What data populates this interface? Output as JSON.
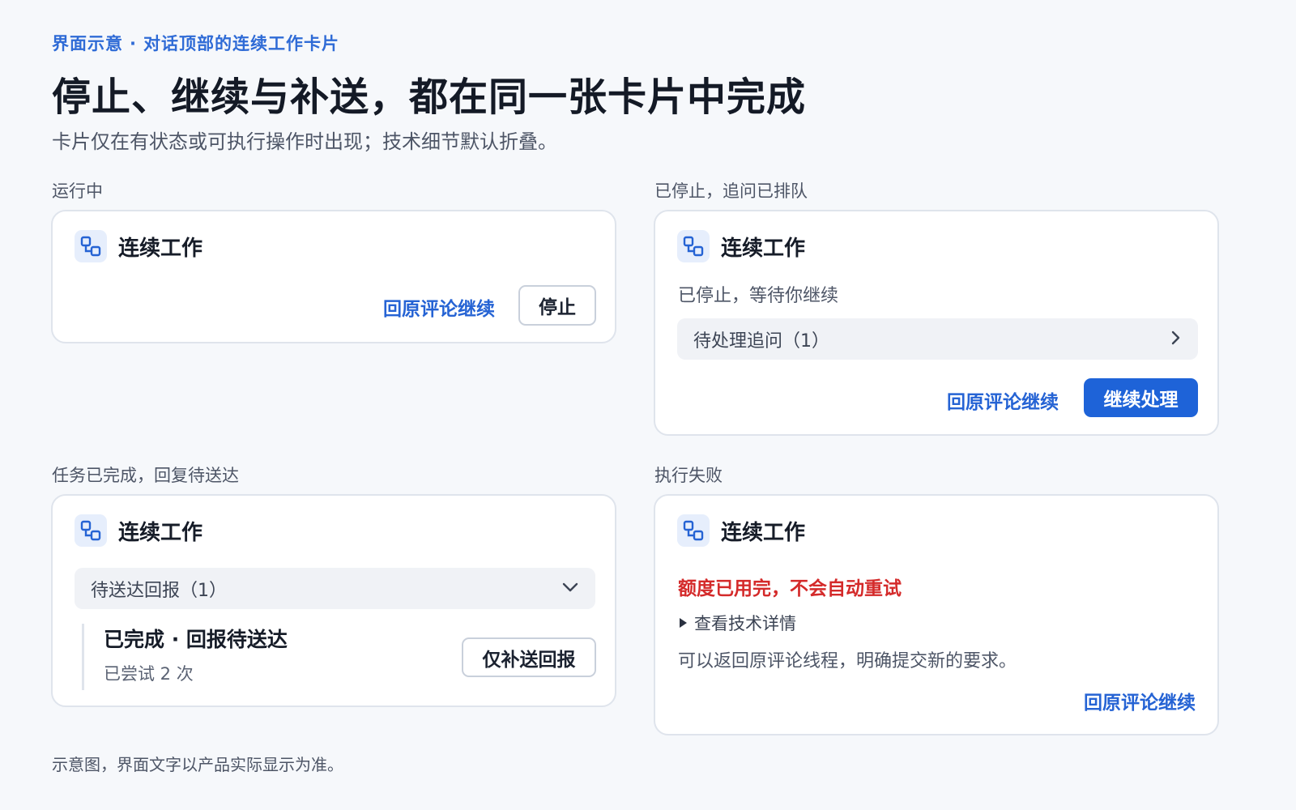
{
  "header": {
    "eyebrow_a": "界面示意",
    "eyebrow_sep": "·",
    "eyebrow_b": "对话顶部的连续工作卡片",
    "title": "停止、继续与补送，都在同一张卡片中完成",
    "subtitle": "卡片仅在有状态或可执行操作时出现；技术细节默认折叠。"
  },
  "running": {
    "label": "运行中",
    "card_title": "连续工作",
    "icon": "flow-icon",
    "link": "回原评论继续",
    "button": "停止"
  },
  "stopped": {
    "label": "已停止，追问已排队",
    "card_title": "连续工作",
    "icon": "flow-icon",
    "status": "已停止，等待你继续",
    "queue_row": "待处理追问（1）",
    "queue_icon": "chevron-right-icon",
    "link": "回原评论继续",
    "button": "继续处理"
  },
  "completed": {
    "label": "任务已完成，回复待送达",
    "card_title": "连续工作",
    "icon": "flow-icon",
    "pending_row": "待送达回报（1）",
    "pending_icon": "chevron-down-icon",
    "item_title": "已完成 · 回报待送达",
    "item_meta": "已尝试 2 次",
    "button": "仅补送回报"
  },
  "failed": {
    "label": "执行失败",
    "card_title": "连续工作",
    "icon": "flow-icon",
    "error": "额度已用完，不会自动重试",
    "details_toggle": "查看技术详情",
    "hint": "可以返回原评论线程，明确提交新的要求。",
    "link": "回原评论继续"
  },
  "footnote": "示意图，界面文字以产品实际显示为准。",
  "colors": {
    "accent": "#1e63d8",
    "link": "#2563d4",
    "error": "#d42a2a",
    "background": "#f6f8fb"
  }
}
